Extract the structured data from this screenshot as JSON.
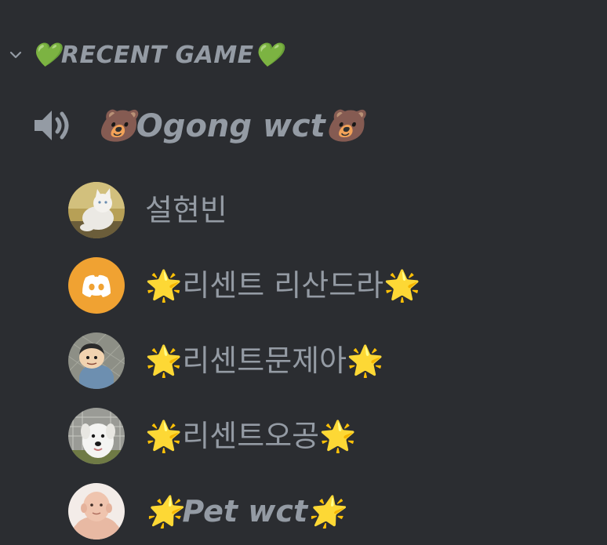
{
  "category": {
    "label": "💚RECENT GAME💚",
    "collapse_icon": "chevron-down-icon"
  },
  "channel": {
    "name": "🐻Ogong wct🐻",
    "icon": "speaker-icon"
  },
  "members": [
    {
      "name": "설현빈",
      "avatar": "cat-photo"
    },
    {
      "name": "🌟리센트 리산드라🌟",
      "avatar": "discord-default-avatar"
    },
    {
      "name": "🌟리센트문제아🌟",
      "avatar": "cartoon-boy-photo"
    },
    {
      "name": "🌟리센트오공🌟",
      "avatar": "white-dog-photo"
    },
    {
      "name": "🌟Pet wct🌟",
      "avatar": "baby-photo"
    }
  ],
  "colors": {
    "background": "#2b2d31",
    "text_muted": "#949ba4",
    "discord_avatar_bg": "#f0a232"
  }
}
